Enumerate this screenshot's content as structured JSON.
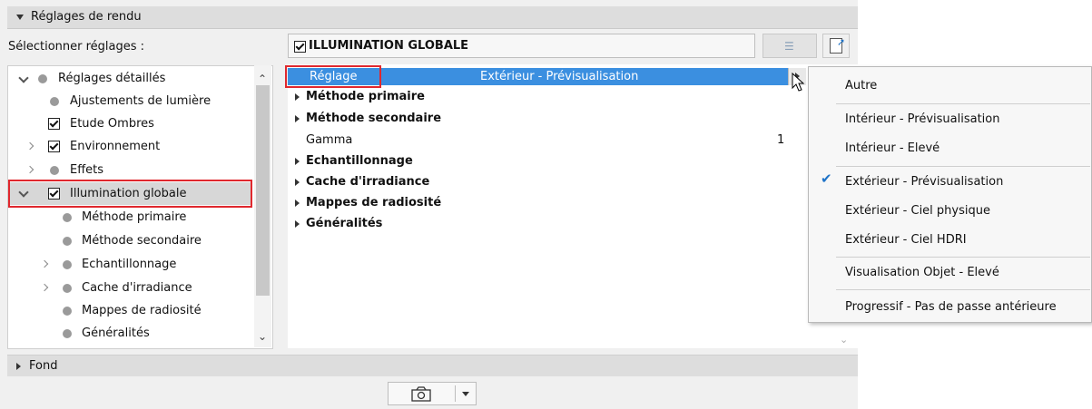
{
  "header": {
    "title": "Réglages de rendu"
  },
  "left": {
    "select_label": "Sélectionner réglages :",
    "tree": [
      {
        "label": "Réglages détaillés"
      },
      {
        "label": "Ajustements de lumière"
      },
      {
        "label": "Etude Ombres"
      },
      {
        "label": "Environnement"
      },
      {
        "label": "Effets"
      },
      {
        "label": "Illumination globale"
      },
      {
        "label": "Méthode primaire"
      },
      {
        "label": "Méthode secondaire"
      },
      {
        "label": "Echantillonnage"
      },
      {
        "label": "Cache d'irradiance"
      },
      {
        "label": "Mappes de radiosité"
      },
      {
        "label": "Généralités"
      }
    ]
  },
  "right": {
    "title": "ILLUMINATION GLOBALE",
    "rows": [
      {
        "label": "Réglage",
        "value": "Extérieur - Prévisualisation"
      },
      {
        "label": "Méthode primaire"
      },
      {
        "label": "Méthode secondaire"
      },
      {
        "label": "Gamma",
        "value": "1"
      },
      {
        "label": "Echantillonnage"
      },
      {
        "label": "Cache d'irradiance"
      },
      {
        "label": "Mappes de radiosité"
      },
      {
        "label": "Généralités"
      }
    ]
  },
  "menu": {
    "items": [
      {
        "label": "Autre"
      },
      {
        "label": "Intérieur - Prévisualisation"
      },
      {
        "label": "Intérieur - Elevé"
      },
      {
        "label": "Extérieur - Prévisualisation",
        "checked": true
      },
      {
        "label": "Extérieur - Ciel physique"
      },
      {
        "label": "Extérieur - Ciel HDRI"
      },
      {
        "label": "Visualisation Objet - Elevé"
      },
      {
        "label": "Progressif - Pas de passe antérieure"
      }
    ]
  },
  "footer": {
    "fond_label": "Fond"
  },
  "colors": {
    "selection": "#3b8fe0",
    "highlight_border": "#e0282e",
    "accent_blue": "#1e73c8"
  }
}
